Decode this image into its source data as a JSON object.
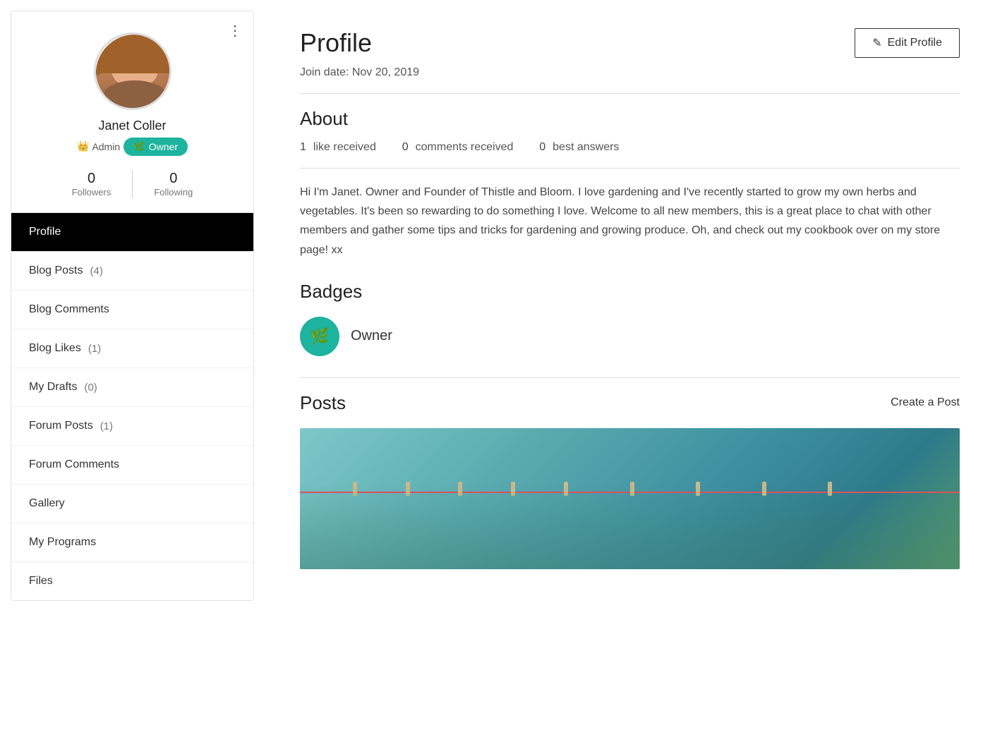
{
  "sidebar": {
    "user_name": "Janet Coller",
    "admin_label": "Admin",
    "owner_label": "Owner",
    "followers_count": "0",
    "followers_label": "Followers",
    "following_count": "0",
    "following_label": "Following",
    "menu_dots": "⋮",
    "nav_items": [
      {
        "id": "profile",
        "label": "Profile",
        "count": null,
        "active": true
      },
      {
        "id": "blog-posts",
        "label": "Blog Posts",
        "count": "4",
        "active": false
      },
      {
        "id": "blog-comments",
        "label": "Blog Comments",
        "count": null,
        "active": false
      },
      {
        "id": "blog-likes",
        "label": "Blog Likes",
        "count": "1",
        "active": false
      },
      {
        "id": "my-drafts",
        "label": "My Drafts",
        "count": "0",
        "active": false
      },
      {
        "id": "forum-posts",
        "label": "Forum Posts",
        "count": "1",
        "active": false
      },
      {
        "id": "forum-comments",
        "label": "Forum Comments",
        "count": null,
        "active": false
      },
      {
        "id": "gallery",
        "label": "Gallery",
        "count": null,
        "active": false
      },
      {
        "id": "my-programs",
        "label": "My Programs",
        "count": null,
        "active": false
      },
      {
        "id": "files",
        "label": "Files",
        "count": null,
        "active": false
      }
    ]
  },
  "main": {
    "page_title": "Profile",
    "edit_button_label": "Edit Profile",
    "join_date": "Join date: Nov 20, 2019",
    "about_title": "About",
    "stats": {
      "likes_count": "1",
      "likes_label": "like received",
      "comments_count": "0",
      "comments_label": "comments received",
      "answers_count": "0",
      "answers_label": "best answers"
    },
    "about_text": "Hi I'm Janet. Owner and Founder of Thistle and Bloom. I love gardening and I've recently started to grow my own herbs and vegetables. It's been so rewarding to do something I love. Welcome to all new members, this is a great place to chat with other members and gather some tips and tricks for gardening and growing produce. Oh, and check out my cookbook over on my store page! xx",
    "badges_title": "Badges",
    "badge_name": "Owner",
    "posts_title": "Posts",
    "create_post_label": "Create a Post"
  },
  "icons": {
    "edit_pencil": "✎",
    "crown": "👑",
    "leaf": "🌿"
  },
  "colors": {
    "teal": "#1db39e",
    "black": "#000000",
    "white": "#ffffff"
  }
}
